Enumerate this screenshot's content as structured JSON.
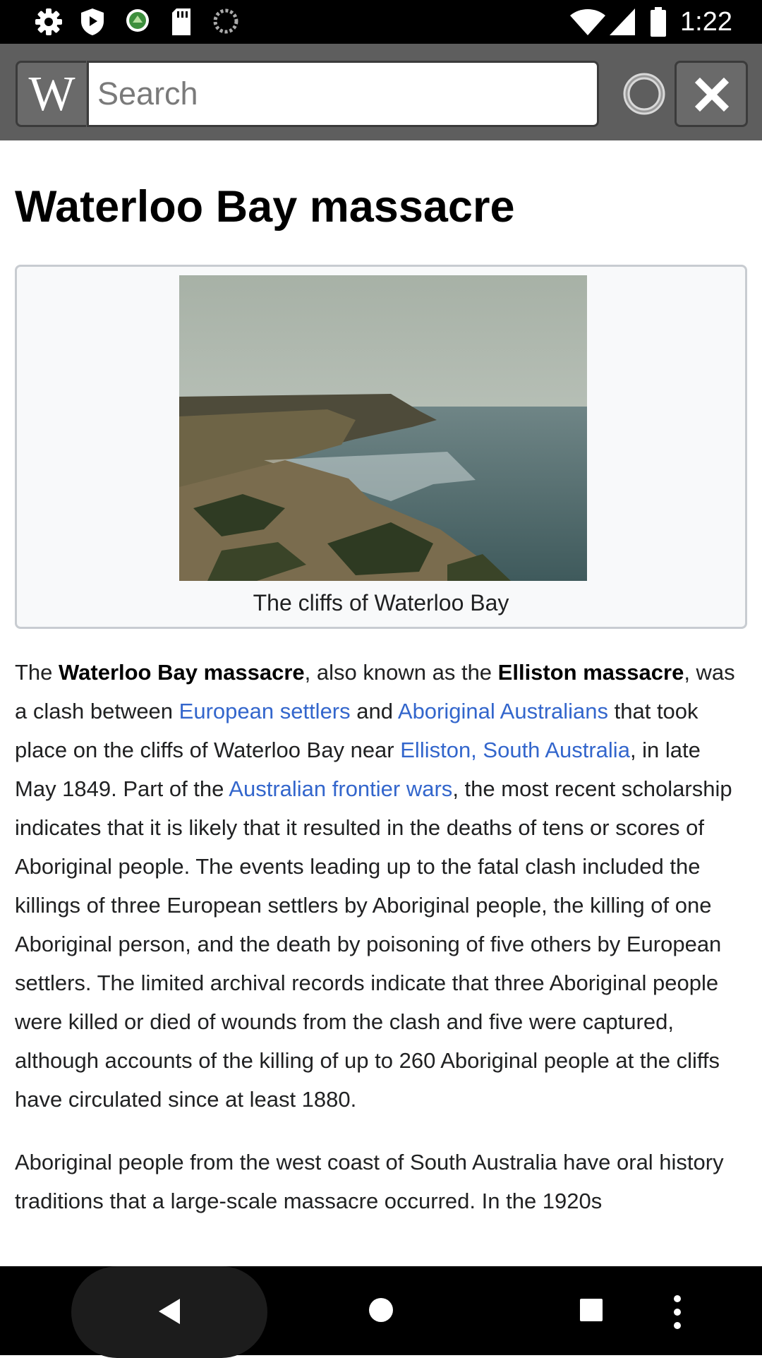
{
  "status_bar": {
    "time": "1:22",
    "left_icons": [
      "settings-icon",
      "shield-icon",
      "app-icon",
      "sd-card-icon",
      "sync-icon"
    ],
    "right_icons": [
      "wifi-icon",
      "signal-icon",
      "battery-icon"
    ]
  },
  "toolbar": {
    "logo_letter": "W",
    "search_placeholder": "Search",
    "search_value": ""
  },
  "article": {
    "title": "Waterloo Bay massacre",
    "image_caption": "The cliffs of Waterloo Bay",
    "p1": {
      "s1": "The ",
      "b1": "Waterloo Bay massacre",
      "s2": ", also known as the ",
      "b2": "Elliston massacre",
      "s3": ", was a clash between ",
      "l1": "European settlers",
      "s4": " and ",
      "l2": "Aboriginal Australians",
      "s5": " that took place on the cliffs of Waterloo Bay near ",
      "l3": "Elliston, South Australia",
      "s6": ", in late May 1849. Part of the ",
      "l4": "Australian frontier wars",
      "s7": ", the most recent scholarship indicates that it is likely that it resulted in the deaths of tens or scores of Aboriginal people. The events leading up to the fatal clash included the killings of three European settlers by Aboriginal people, the killing of one Aboriginal person, and the death by poisoning of five others by European settlers. The limited archival records indicate that three Aboriginal people were killed or died of wounds from the clash and five were captured, although accounts of the killing of up to 260 Aboriginal people at the cliffs have circulated since at least 1880."
    },
    "p2": "Aboriginal people from the west coast of South Australia have oral history traditions that a large-scale massacre occurred. In the 1920s"
  },
  "nav_bar": {
    "buttons": [
      "back-icon",
      "home-icon",
      "recents-icon",
      "menu-icon"
    ]
  }
}
